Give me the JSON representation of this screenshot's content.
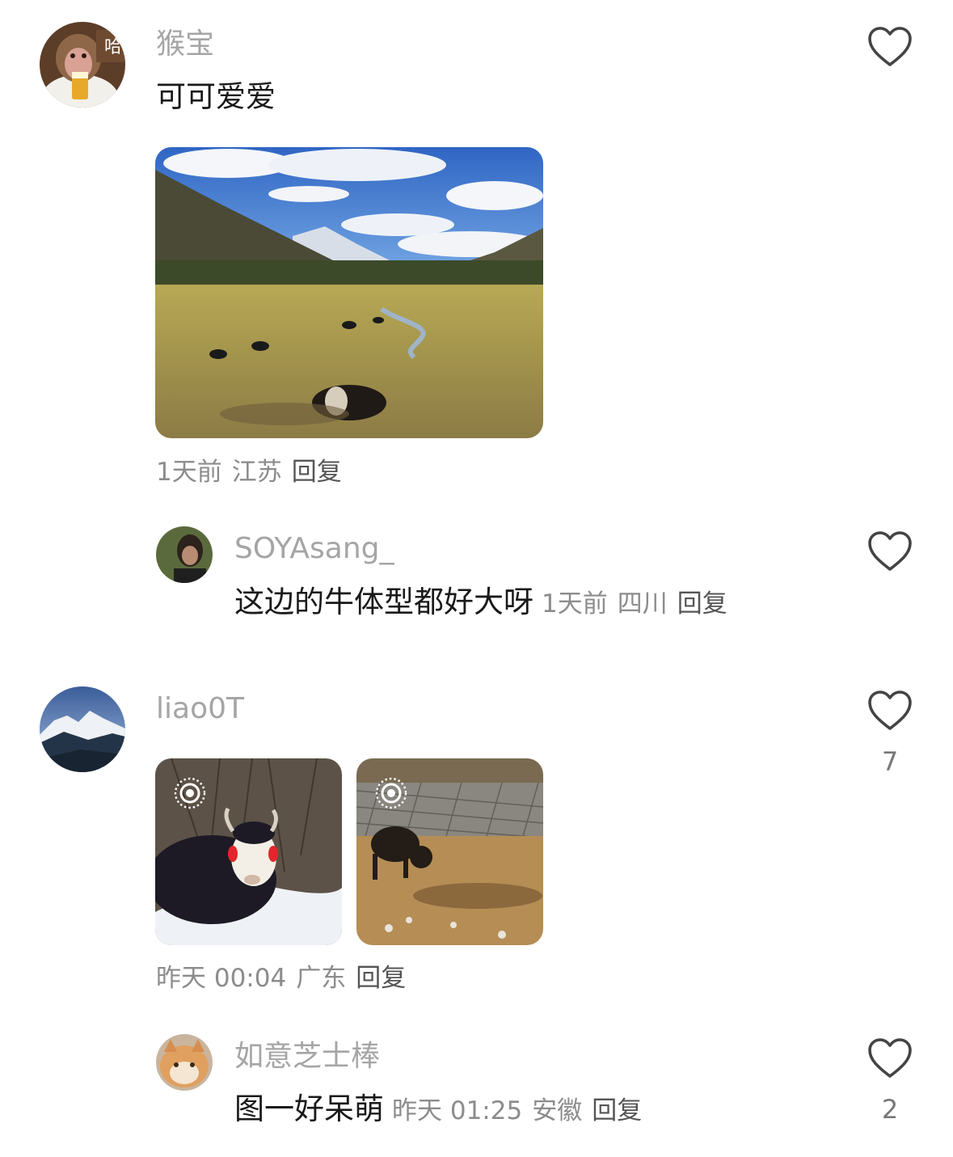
{
  "comments": [
    {
      "username": "猴宝",
      "avatar_text": "哈",
      "text": "可可爱爱",
      "time": "1天前",
      "location": "江苏",
      "reply_label": "回复",
      "replies": [
        {
          "username": "SOYAsang_",
          "text": "这边的牛体型都好大呀",
          "time": "1天前",
          "location": "四川",
          "reply_label": "回复"
        }
      ]
    },
    {
      "username": "liao0T",
      "time": "昨天 00:04",
      "location": "广东",
      "reply_label": "回复",
      "like_count": "7",
      "replies": [
        {
          "username": "如意芝士棒",
          "text": "图一好呆萌",
          "time": "昨天 01:25",
          "location": "安徽",
          "reply_label": "回复",
          "like_count": "2"
        }
      ]
    }
  ],
  "icons": {
    "like": "heart-outline-icon",
    "live_photo": "live-photo-icon"
  },
  "colors": {
    "username": "#a5a5a5",
    "text": "#1a1a1a",
    "meta": "#8c8c8c",
    "icon": "#444444"
  }
}
